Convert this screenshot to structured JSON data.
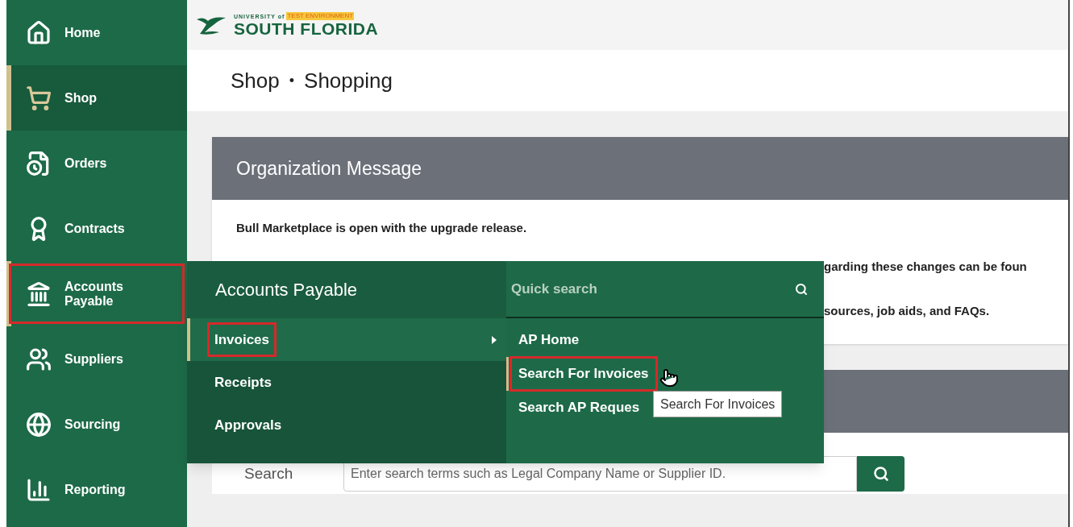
{
  "logo": {
    "top_text": "UNIVERSITY of",
    "badge": "TEST ENVIRONMENT",
    "name": "SOUTH FLORIDA"
  },
  "breadcrumb": {
    "items": [
      "Shop",
      "Shopping"
    ],
    "separator": "•"
  },
  "sidebar": {
    "items": [
      {
        "label": "Home",
        "kind": "home",
        "selected": false,
        "expanded": false,
        "highlighted": false
      },
      {
        "label": "Shop",
        "kind": "cart",
        "selected": true,
        "expanded": false,
        "highlighted": false
      },
      {
        "label": "Orders",
        "kind": "orders",
        "selected": false,
        "expanded": false,
        "highlighted": false
      },
      {
        "label": "Contracts",
        "kind": "award",
        "selected": false,
        "expanded": false,
        "highlighted": false
      },
      {
        "label": "Accounts Payable",
        "kind": "bank",
        "selected": false,
        "expanded": true,
        "highlighted": true
      },
      {
        "label": "Suppliers",
        "kind": "users",
        "selected": false,
        "expanded": false,
        "highlighted": false
      },
      {
        "label": "Sourcing",
        "kind": "globe",
        "selected": false,
        "expanded": false,
        "highlighted": false
      },
      {
        "label": "Reporting",
        "kind": "chart",
        "selected": false,
        "expanded": false,
        "highlighted": false
      }
    ]
  },
  "flyout": {
    "title": "Accounts Payable",
    "items": [
      {
        "label": "Invoices",
        "selected": true,
        "highlighted": true,
        "has_submenu": true
      },
      {
        "label": "Receipts",
        "selected": false,
        "highlighted": false,
        "has_submenu": false
      },
      {
        "label": "Approvals",
        "selected": false,
        "highlighted": false,
        "has_submenu": false
      }
    ],
    "submenu": {
      "search_placeholder": "Quick search",
      "items": [
        {
          "label": "AP Home",
          "selected": false,
          "highlighted": false
        },
        {
          "label": "Search For Invoices",
          "selected": true,
          "highlighted": true
        },
        {
          "label": "Search AP Reques",
          "selected": false,
          "highlighted": false
        }
      ]
    },
    "tooltip": "Search For Invoices"
  },
  "org_message": {
    "title": "Organization Message",
    "lead": "Bull Marketplace is open with the upgrade release.",
    "visible_fragments": [
      "garding these changes can be foun",
      "sources, job aids, and FAQs."
    ]
  },
  "search": {
    "label": "Search",
    "placeholder": "Enter search terms such as Legal Company Name or Supplier ID."
  }
}
